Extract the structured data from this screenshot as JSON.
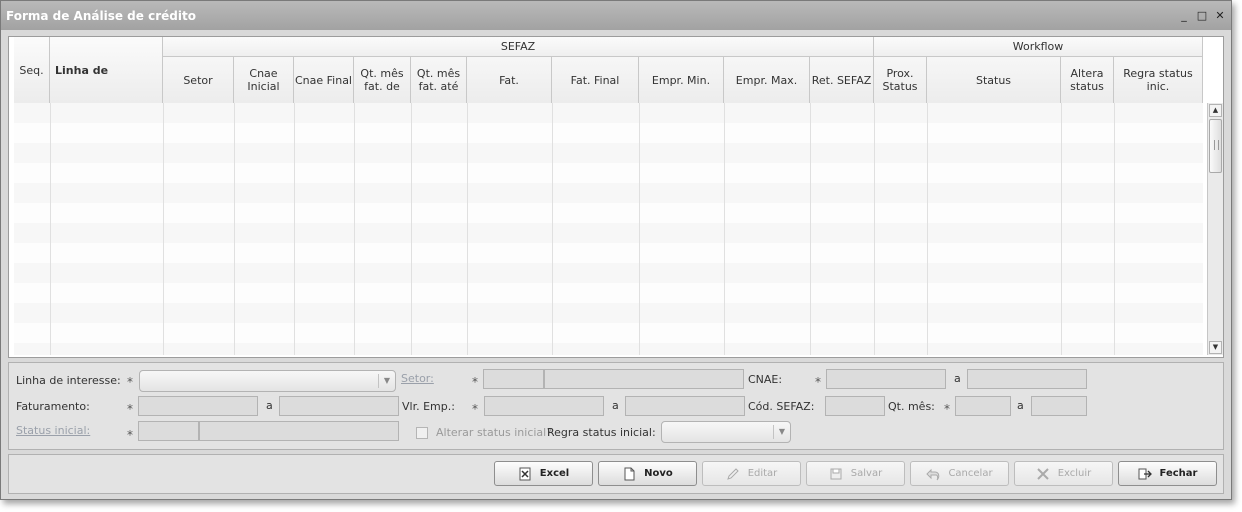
{
  "window": {
    "title": "Forma de Análise de crédito",
    "controls": [
      "_",
      "□",
      "✕"
    ]
  },
  "grid": {
    "groups": {
      "sefaz": "SEFAZ",
      "workflow": "Workflow"
    },
    "columns": {
      "seq": "Seq.",
      "linha": "Linha de",
      "setor": "Setor",
      "cnae_ini": "Cnae Inicial",
      "cnae_fin": "Cnae Final",
      "qt_de": "Qt. mês fat. de",
      "qt_ate": "Qt. mês fat. até",
      "fat": "Fat.",
      "fat_final": "Fat. Final",
      "empr_min": "Empr. Min.",
      "empr_max": "Empr. Max.",
      "ret_sefaz": "Ret. SEFAZ",
      "prox_status": "Prox. Status",
      "status": "Status",
      "altera": "Altera status",
      "regra": "Regra status inic."
    },
    "scroll_up": "▲",
    "scroll_down": "▼"
  },
  "form": {
    "linha_interesse": "Linha de interesse:",
    "setor": "Setor:",
    "cnae": "CNAE:",
    "faturamento": "Faturamento:",
    "vlr_emp": "Vlr. Emp.:",
    "cod_sefaz": "Cód. SEFAZ:",
    "qt_mes": "Qt. mês:",
    "status_inicial": "Status inicial:",
    "alterar_status": "Alterar status inicial?",
    "regra_status": "Regra status inicial:",
    "a": "a",
    "req": "*",
    "combo_arrow": "▼"
  },
  "buttons": {
    "excel": "Excel",
    "novo": "Novo",
    "editar": "Editar",
    "salvar": "Salvar",
    "cancelar": "Cancelar",
    "excluir": "Excluir",
    "fechar": "Fechar"
  }
}
